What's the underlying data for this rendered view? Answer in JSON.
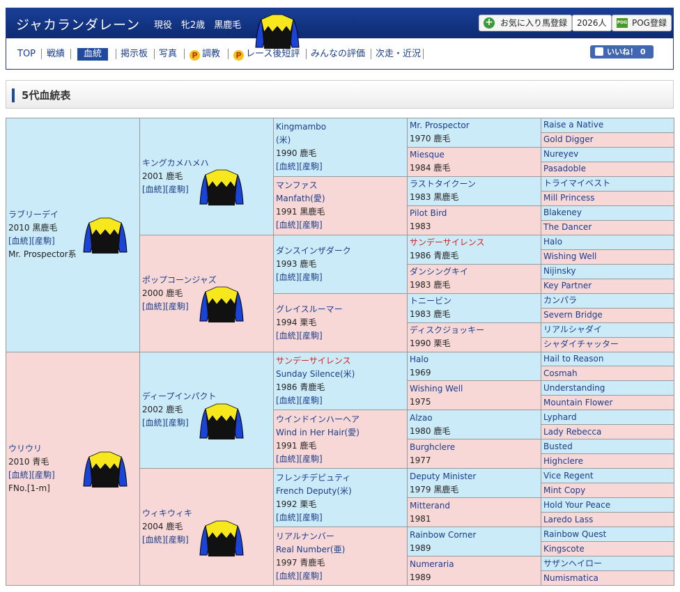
{
  "header": {
    "horse_name": "ジャカランダレーン",
    "info": "現役　牝2歳　黒鹿毛",
    "fav_label": "お気に入り馬登録",
    "fav_count": "2026人",
    "pog_label": "POG登録",
    "pog_icon_text": "POG",
    "plus_icon": "+"
  },
  "nav": {
    "items": [
      "TOP",
      "戦績",
      "血統",
      "掲示板",
      "写真",
      "調教",
      "レース後短評",
      "みんなの評価",
      "次走・近況"
    ],
    "p_icon": "P",
    "like_label": "いいね！ 0"
  },
  "section": {
    "title": "5代血統表"
  },
  "links": {
    "blood": "[血統]",
    "offspring": "[産駒]"
  },
  "pedigree": {
    "g1": [
      {
        "name": "ラブリーデイ",
        "year": "2010 黒鹿毛",
        "note": "Mr. Prospector系"
      },
      {
        "name": "ウリウリ",
        "year": "2010 青毛",
        "note": "FNo.[1-m]"
      }
    ],
    "g2": [
      {
        "name": "キングカメハメハ",
        "year": "2001 鹿毛"
      },
      {
        "name": "ポップコーンジャズ",
        "year": "2000 鹿毛"
      },
      {
        "name": "ディープインパクト",
        "year": "2002 鹿毛"
      },
      {
        "name": "ウィキウィキ",
        "year": "2004 鹿毛"
      }
    ],
    "g3": [
      {
        "name": "Kingmambo",
        "sub": "(米)",
        "year": "1990 鹿毛"
      },
      {
        "name": "マンファス",
        "sub": "Manfath(愛)",
        "year": "1991 黒鹿毛"
      },
      {
        "name": "ダンスインザダーク",
        "sub": "",
        "year": "1993 鹿毛"
      },
      {
        "name": "グレイスルーマー",
        "sub": "",
        "year": "1994 栗毛"
      },
      {
        "name": "サンデーサイレンス",
        "sub": "Sunday Silence(米)",
        "year": "1986 青鹿毛"
      },
      {
        "name": "ウインドインハーヘア",
        "sub": "Wind in Her Hair(愛)",
        "year": "1991 鹿毛"
      },
      {
        "name": "フレンチデピュティ",
        "sub": "French Deputy(米)",
        "year": "1992 栗毛"
      },
      {
        "name": "リアルナンバー",
        "sub": "Real Number(亜)",
        "year": "1997 青鹿毛"
      }
    ],
    "g4": [
      {
        "name": "Mr. Prospector",
        "year": "1970 鹿毛"
      },
      {
        "name": "Miesque",
        "year": "1984 鹿毛"
      },
      {
        "name": "ラストタイクーン",
        "year": "1983 黒鹿毛"
      },
      {
        "name": "Pilot Bird",
        "year": "1983"
      },
      {
        "name": "サンデーサイレンス",
        "year": "1986 青鹿毛"
      },
      {
        "name": "ダンシングキイ",
        "year": "1983 鹿毛"
      },
      {
        "name": "トニービン",
        "year": "1983 鹿毛"
      },
      {
        "name": "ディスクジョッキー",
        "year": "1990 栗毛"
      },
      {
        "name": "Halo",
        "year": "1969"
      },
      {
        "name": "Wishing Well",
        "year": "1975"
      },
      {
        "name": "Alzao",
        "year": "1980 鹿毛"
      },
      {
        "name": "Burghclere",
        "year": "1977"
      },
      {
        "name": "Deputy Minister",
        "year": "1979 黒鹿毛"
      },
      {
        "name": "Mitterand",
        "year": "1981"
      },
      {
        "name": "Rainbow Corner",
        "year": "1989"
      },
      {
        "name": "Numeraria",
        "year": "1989"
      }
    ],
    "g5": [
      "Raise a Native",
      "Gold Digger",
      "Nureyev",
      "Pasadoble",
      "トライマイベスト",
      "Mill Princess",
      "Blakeney",
      "The Dancer",
      "Halo",
      "Wishing Well",
      "Nijinsky",
      "Key Partner",
      "カンパラ",
      "Severn Bridge",
      "リアルシャダイ",
      "シャダイチャッター",
      "Hail to Reason",
      "Cosmah",
      "Understanding",
      "Mountain Flower",
      "Lyphard",
      "Lady Rebecca",
      "Busted",
      "Highclere",
      "Vice Regent",
      "Mint Copy",
      "Hold Your Peace",
      "Laredo Lass",
      "Rainbow Quest",
      "Kingscote",
      "サザンヘイロー",
      "Numismatica"
    ]
  }
}
